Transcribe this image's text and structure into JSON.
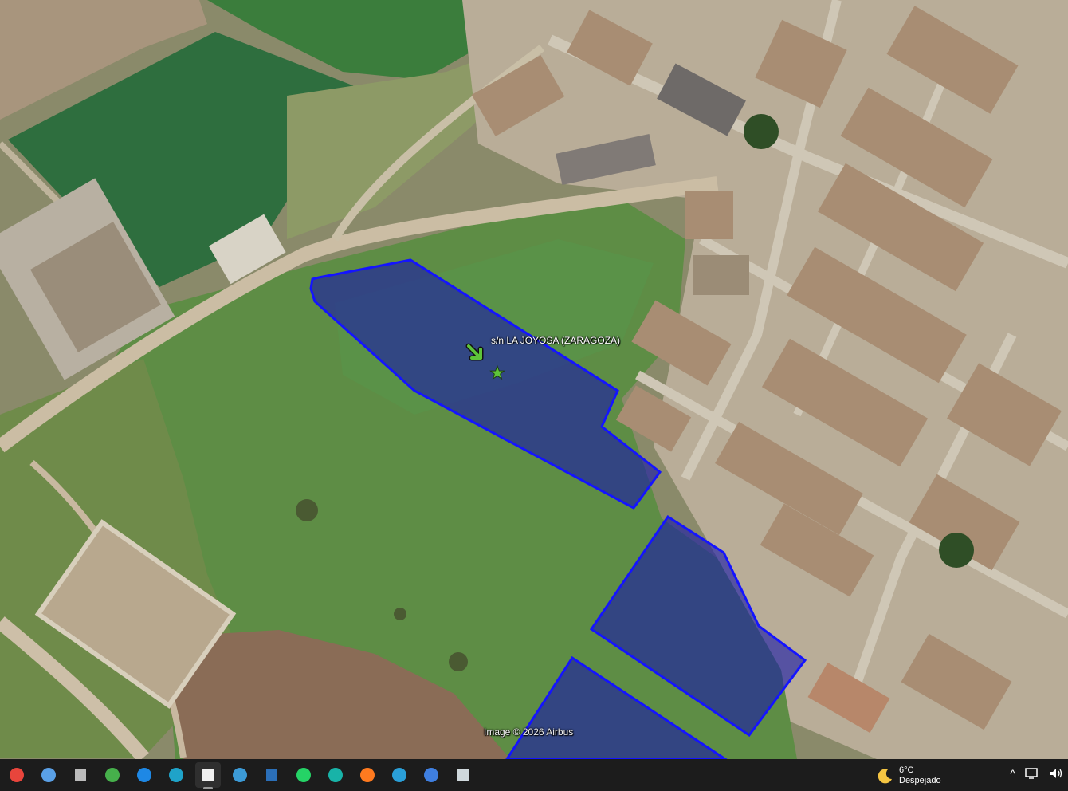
{
  "map": {
    "placemark_label": "s/n LA JOYOSA (ZARAGOZA)",
    "credit": "Image © 2026 Airbus",
    "polygon_fill": "#1a1aa8",
    "polygon_stroke": "#1414ff",
    "placemark_color": "#5ec43a"
  },
  "taskbar": {
    "apps": [
      {
        "name": "chrome-icon",
        "color": "#e8453c"
      },
      {
        "name": "photos-icon",
        "color": "#5aa0e6"
      },
      {
        "name": "printer-icon",
        "color": "#bbbbbb"
      },
      {
        "name": "network-share-icon",
        "color": "#46b04b"
      },
      {
        "name": "image-viewer-icon",
        "color": "#1e88e5"
      },
      {
        "name": "edge-icon",
        "color": "#1fa3c9"
      },
      {
        "name": "document-icon",
        "color": "#f0f0f0"
      },
      {
        "name": "globe-icon",
        "color": "#3c9ad6"
      },
      {
        "name": "save-disk-icon",
        "color": "#2b6fb8"
      },
      {
        "name": "whatsapp-icon",
        "color": "#25d366"
      },
      {
        "name": "antenna-icon",
        "color": "#18b3a8"
      },
      {
        "name": "firefox-icon",
        "color": "#ff7a1f"
      },
      {
        "name": "dollar-app-icon",
        "color": "#2a9fd8"
      },
      {
        "name": "vector-app-icon",
        "color": "#3f7fe0"
      },
      {
        "name": "window-app-icon",
        "color": "#cfd8dc"
      }
    ],
    "active_app": "document-icon",
    "weather": {
      "temp": "6°C",
      "desc": "Despejado"
    },
    "tray": {
      "chevron": "^"
    }
  }
}
